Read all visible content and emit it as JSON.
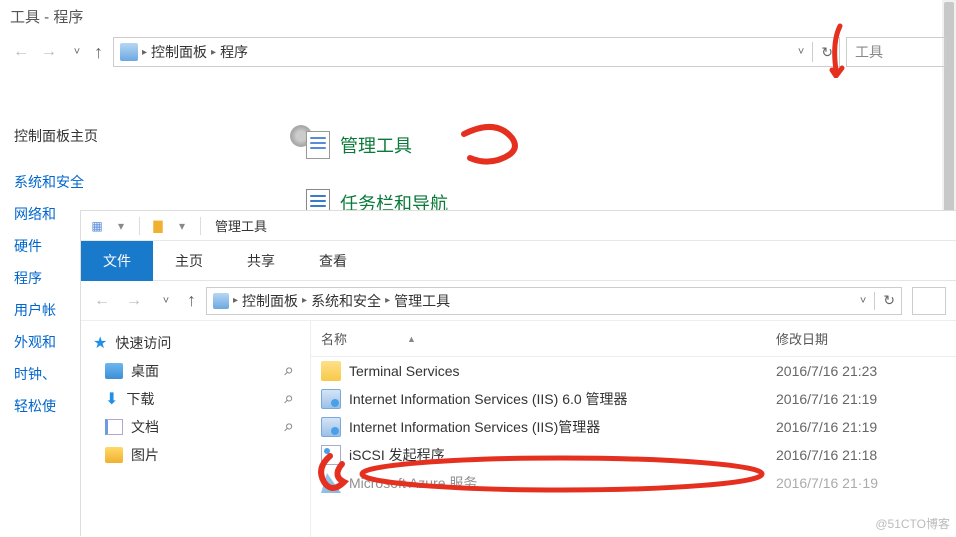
{
  "win1": {
    "title": "工具 - 程序",
    "breadcrumb": {
      "root_icon": "control-panel",
      "seg1": "控制面板",
      "seg2": "程序"
    },
    "search_hint": "工具",
    "sidebar": {
      "head": "控制面板主页",
      "items": [
        "系统和安全",
        "网络和",
        "硬件",
        "程序",
        "用户帐",
        "外观和",
        "时钟、",
        "轻松使"
      ]
    },
    "main": {
      "item1": "管理工具",
      "item2": "任务栏和导航"
    }
  },
  "win2": {
    "titlebar_title": "管理工具",
    "tabs": {
      "t0": "文件",
      "t1": "主页",
      "t2": "共享",
      "t3": "查看"
    },
    "breadcrumb": {
      "seg1": "控制面板",
      "seg2": "系统和安全",
      "seg3": "管理工具"
    },
    "nav": {
      "top": "快速访问",
      "items": [
        {
          "label": "桌面",
          "icon": "desktop"
        },
        {
          "label": "下载",
          "icon": "download"
        },
        {
          "label": "文档",
          "icon": "document"
        },
        {
          "label": "图片",
          "icon": "picture"
        }
      ]
    },
    "list": {
      "head_name": "名称",
      "head_date": "修改日期",
      "rows": [
        {
          "name": "Terminal Services",
          "date": "2016/7/16 21:23",
          "icon": "folder"
        },
        {
          "name": "Internet Information Services (IIS) 6.0 管理器",
          "date": "2016/7/16 21:19",
          "icon": "iis"
        },
        {
          "name": "Internet Information Services (IIS)管理器",
          "date": "2016/7/16 21:19",
          "icon": "iis"
        },
        {
          "name": "iSCSI 发起程序",
          "date": "2016/7/16 21:18",
          "icon": "iscsi"
        },
        {
          "name": "Microsoft Azure 服务",
          "date": "2016/7/16 21·19",
          "icon": "azure"
        }
      ]
    }
  },
  "watermark": "@51CTO博客"
}
